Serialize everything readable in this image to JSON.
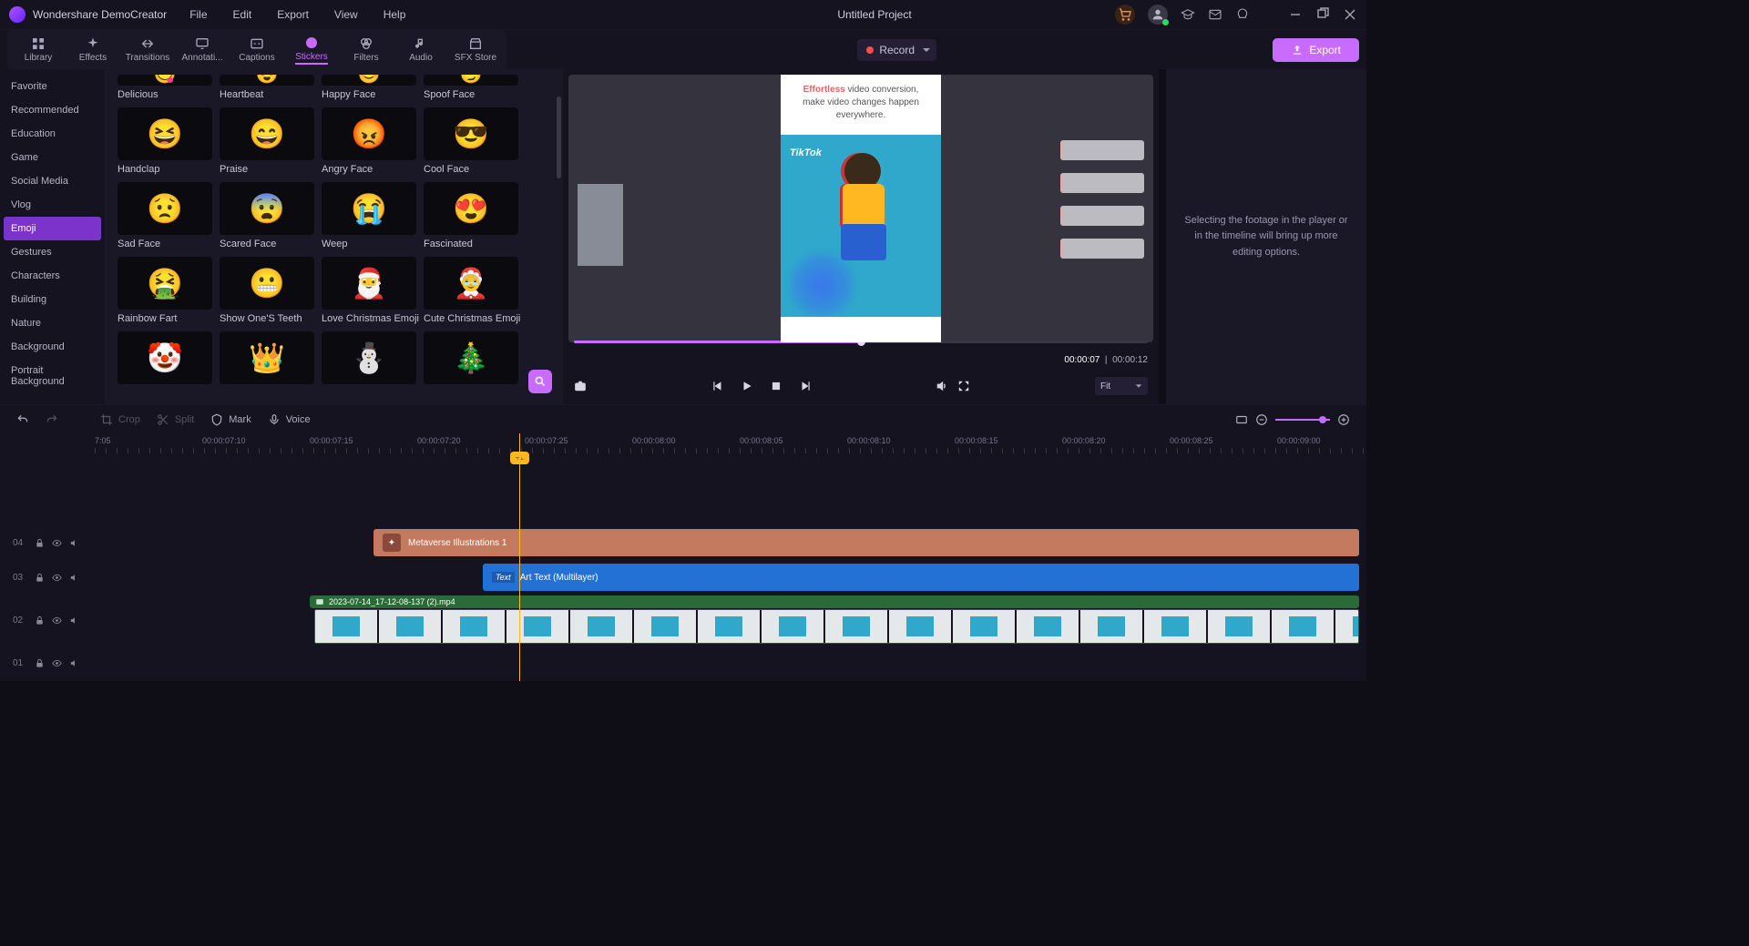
{
  "app": {
    "name": "Wondershare DemoCreator",
    "project": "Untitled Project"
  },
  "menu": [
    "File",
    "Edit",
    "Export",
    "View",
    "Help"
  ],
  "toolbar": {
    "tabs": [
      {
        "id": "library",
        "label": "Library"
      },
      {
        "id": "effects",
        "label": "Effects"
      },
      {
        "id": "transitions",
        "label": "Transitions"
      },
      {
        "id": "annotations",
        "label": "Annotati..."
      },
      {
        "id": "captions",
        "label": "Captions"
      },
      {
        "id": "stickers",
        "label": "Stickers",
        "active": true
      },
      {
        "id": "filters",
        "label": "Filters"
      },
      {
        "id": "audio",
        "label": "Audio"
      },
      {
        "id": "sfx",
        "label": "SFX Store"
      }
    ],
    "record": "Record",
    "export": "Export"
  },
  "sidebar": {
    "items": [
      "Favorite",
      "Recommended",
      "Education",
      "Game",
      "Social Media",
      "Vlog",
      "Emoji",
      "Gestures",
      "Characters",
      "Building",
      "Nature",
      "Background",
      "Portrait Background"
    ],
    "active": "Emoji"
  },
  "stickers": [
    {
      "label": "Delicious",
      "glyph": "😋"
    },
    {
      "label": "Heartbeat",
      "glyph": "😍"
    },
    {
      "label": "Happy Face",
      "glyph": "😊"
    },
    {
      "label": "Spoof Face",
      "glyph": "😏"
    },
    {
      "label": "Handclap",
      "glyph": "😆"
    },
    {
      "label": "Praise",
      "glyph": "😄"
    },
    {
      "label": "Angry Face",
      "glyph": "😡"
    },
    {
      "label": "Cool Face",
      "glyph": "😎"
    },
    {
      "label": "Sad Face",
      "glyph": "😟"
    },
    {
      "label": "Scared Face",
      "glyph": "😨"
    },
    {
      "label": "Weep",
      "glyph": "😭"
    },
    {
      "label": "Fascinated",
      "glyph": "😍"
    },
    {
      "label": "Rainbow Fart",
      "glyph": "🤮"
    },
    {
      "label": "Show One'S Teeth",
      "glyph": "😬"
    },
    {
      "label": "Love Christmas Emoji",
      "glyph": "🎅"
    },
    {
      "label": "Cute Christmas Emoji",
      "glyph": "🤶"
    },
    {
      "label": "",
      "glyph": "🤡"
    },
    {
      "label": "",
      "glyph": "👑"
    },
    {
      "label": "",
      "glyph": "⛄"
    },
    {
      "label": "",
      "glyph": "🎄"
    }
  ],
  "preview": {
    "overlay1": "Effortless",
    "overlay_cont": " video conversion,",
    "overlay2": "make video changes happen everywhere.",
    "tiktok": "TikTok",
    "time_current": "00:00:07",
    "time_total": "00:00:12",
    "fit": "Fit"
  },
  "props": {
    "placeholder": "Selecting the footage in the player or in the timeline will bring up more editing options."
  },
  "timeline_tools": {
    "crop": "Crop",
    "split": "Split",
    "mark": "Mark",
    "voice": "Voice"
  },
  "ruler": [
    "7:05",
    "00:00:07:10",
    "00:00:07:15",
    "00:00:07:20",
    "00:00:07:25",
    "00:00:08:00",
    "00:00:08:05",
    "00:00:08:10",
    "00:00:08:15",
    "00:00:08:20",
    "00:00:08:25",
    "00:00:09:00"
  ],
  "tracks": {
    "t4": "04",
    "t3": "03",
    "t2": "02",
    "t1": "01",
    "clip4": "Metaverse Illustrations 1",
    "clip3_badge": "Text",
    "clip3": "Art Text (Multilayer)",
    "clip2": "2023-07-14_17-12-08-137 (2).mp4"
  },
  "playhead": "⫟⫠"
}
